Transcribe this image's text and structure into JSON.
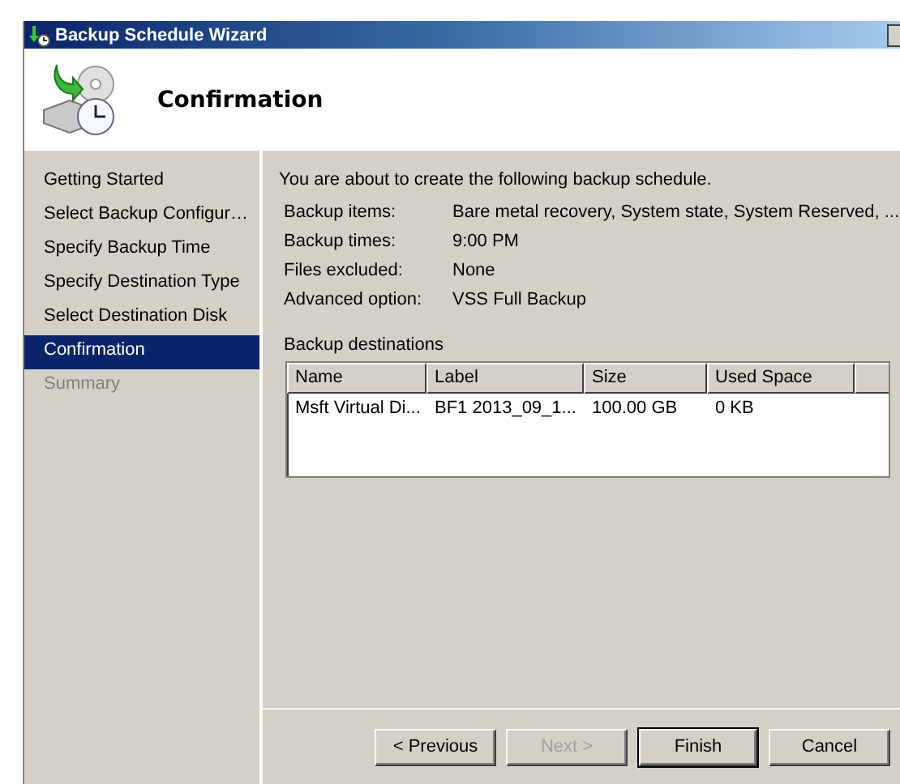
{
  "window": {
    "title": "Backup Schedule Wizard"
  },
  "header": {
    "title": "Confirmation"
  },
  "nav": [
    {
      "label": "Getting Started",
      "selected": false,
      "disabled": false
    },
    {
      "label": "Select Backup Configur…",
      "selected": false,
      "disabled": false
    },
    {
      "label": "Specify Backup Time",
      "selected": false,
      "disabled": false
    },
    {
      "label": "Specify Destination Type",
      "selected": false,
      "disabled": false
    },
    {
      "label": "Select Destination Disk",
      "selected": false,
      "disabled": false
    },
    {
      "label": "Confirmation",
      "selected": true,
      "disabled": false
    },
    {
      "label": "Summary",
      "selected": false,
      "disabled": true
    }
  ],
  "intro": "You are about to create the following backup schedule.",
  "details": [
    {
      "label": "Backup items:",
      "value": "Bare metal recovery, System state, System Reserved, ..."
    },
    {
      "label": "Backup times:",
      "value": "9:00 PM"
    },
    {
      "label": "Files excluded:",
      "value": "None"
    },
    {
      "label": "Advanced option:",
      "value": "VSS Full Backup"
    }
  ],
  "destinations": {
    "title": "Backup destinations",
    "columns": [
      "Name",
      "Label",
      "Size",
      "Used Space"
    ],
    "rows": [
      [
        "Msft Virtual Di...",
        "BF1 2013_09_1...",
        "100.00 GB",
        "0 KB"
      ]
    ]
  },
  "buttons": [
    {
      "label": "< Previous",
      "disabled": false,
      "default": false
    },
    {
      "label": "Next >",
      "disabled": true,
      "default": false
    },
    {
      "label": "Finish",
      "disabled": false,
      "default": true
    },
    {
      "label": "Cancel",
      "disabled": false,
      "default": false
    }
  ]
}
